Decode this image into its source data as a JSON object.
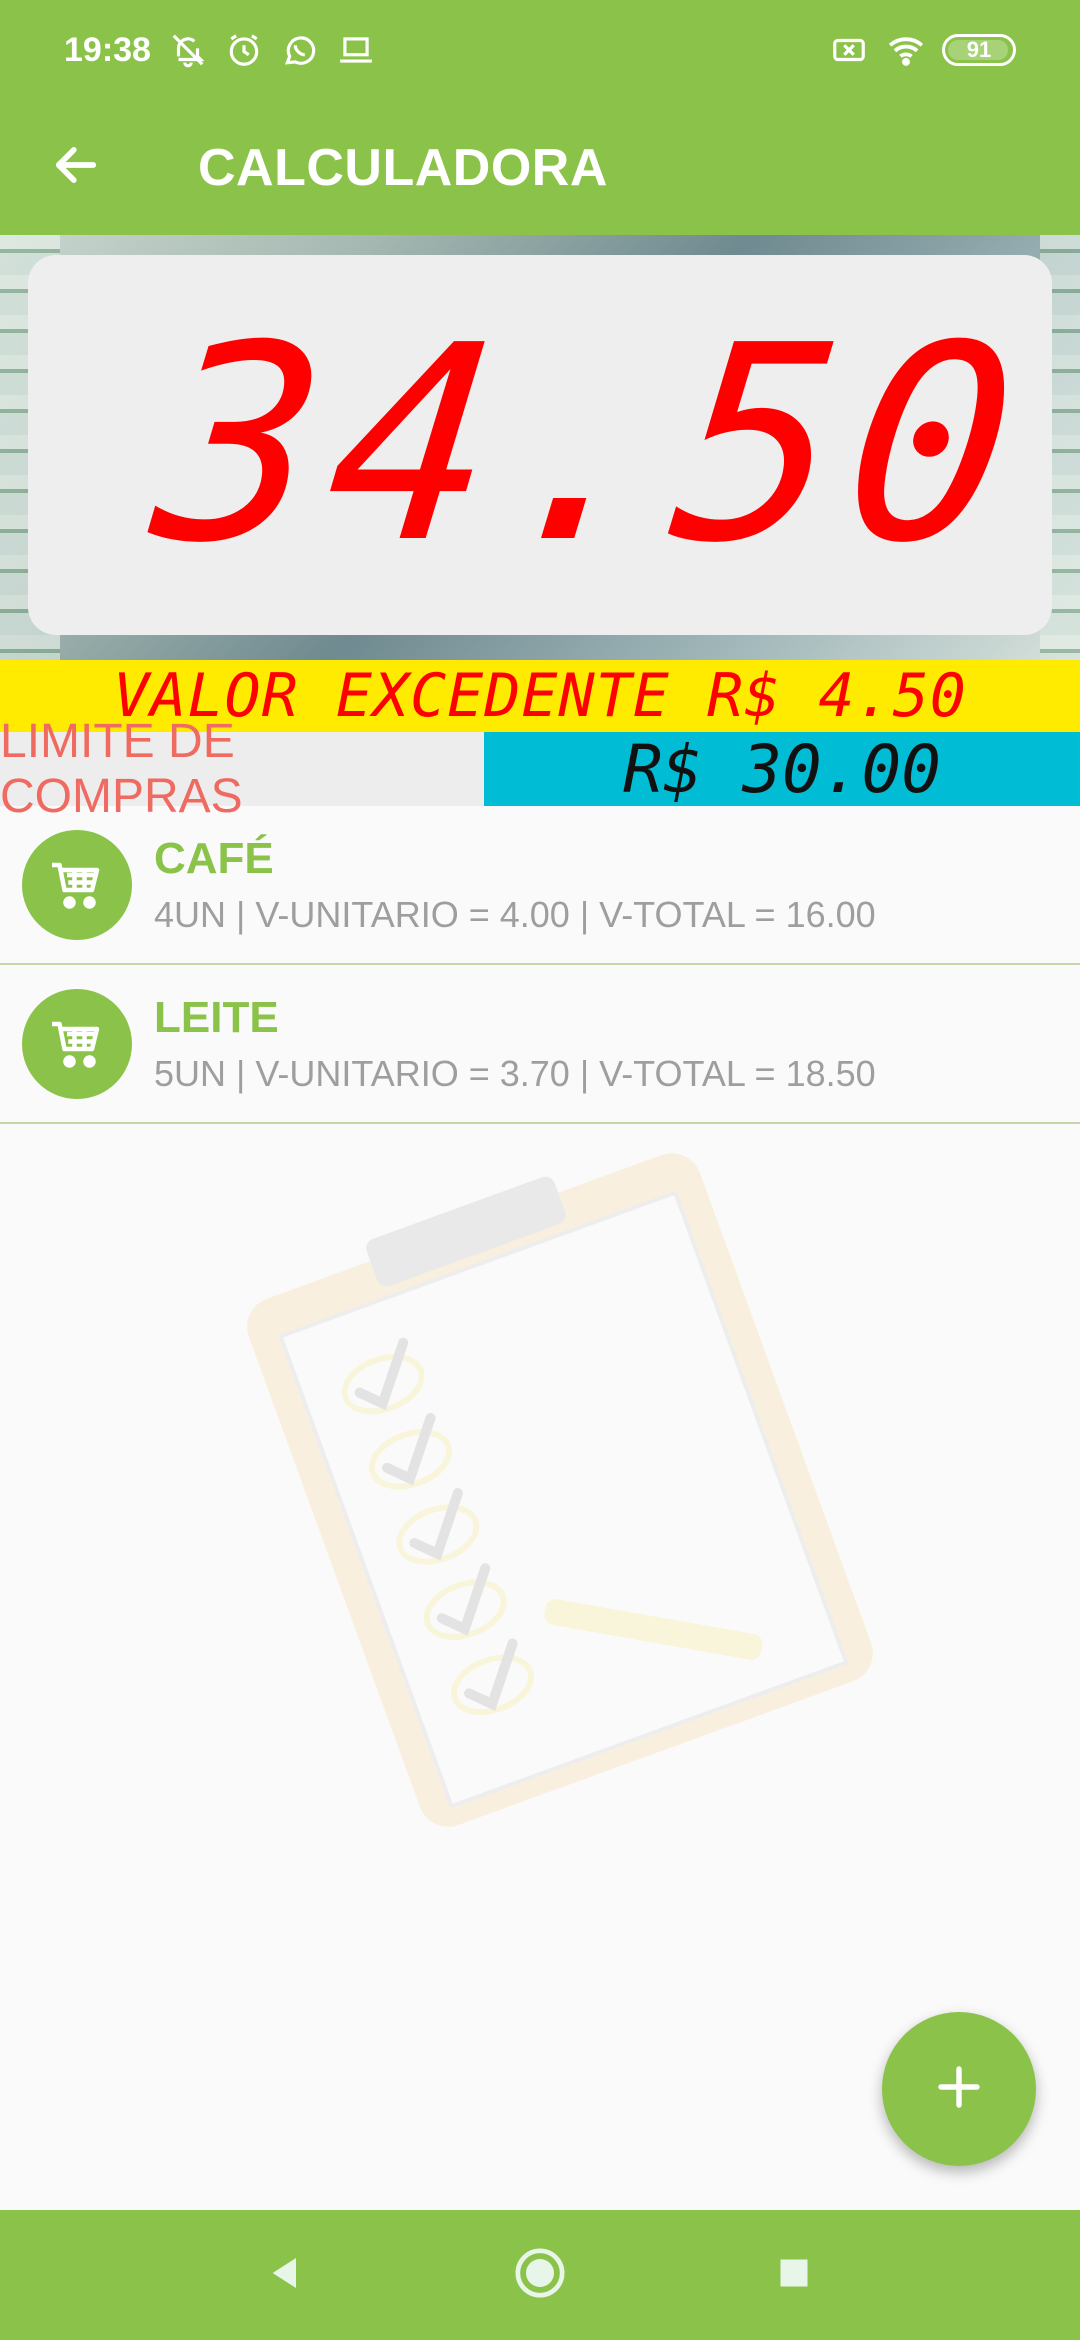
{
  "status_bar": {
    "time": "19:38",
    "battery": "91",
    "left_icons": [
      "bell-off-icon",
      "alarm-icon",
      "whatsapp-icon",
      "laptop-icon"
    ],
    "right_icons": [
      "sim-disabled-icon",
      "wifi-icon",
      "battery-icon"
    ]
  },
  "app_bar": {
    "title": "CALCULADORA",
    "back_icon": "arrow-left-icon"
  },
  "display": {
    "value": "34.50"
  },
  "excess": {
    "text": "VALOR EXCEDENTE R$ 4.50"
  },
  "limit": {
    "label": "LIMITE DE COMPRAS",
    "value": "R$ 30.00"
  },
  "items": [
    {
      "name": "CAFÉ",
      "detail": "4UN  | V-UNITARIO =  4.00  | V-TOTAL =  16.00",
      "icon": "shopping-cart-icon"
    },
    {
      "name": "LEITE",
      "detail": "5UN  | V-UNITARIO =  3.70  | V-TOTAL =  18.50",
      "icon": "shopping-cart-icon"
    }
  ],
  "fab": {
    "icon": "plus-icon"
  },
  "nav": {
    "back": "triangle-back-icon",
    "home": "circle-home-icon",
    "recents": "square-recents-icon"
  },
  "colors": {
    "primary": "#8bc34a",
    "display_digits": "#ff0000",
    "excess_bg": "#ffeb00",
    "limit_value_bg": "#00bcd4",
    "limit_label_text": "#ef6a60"
  }
}
